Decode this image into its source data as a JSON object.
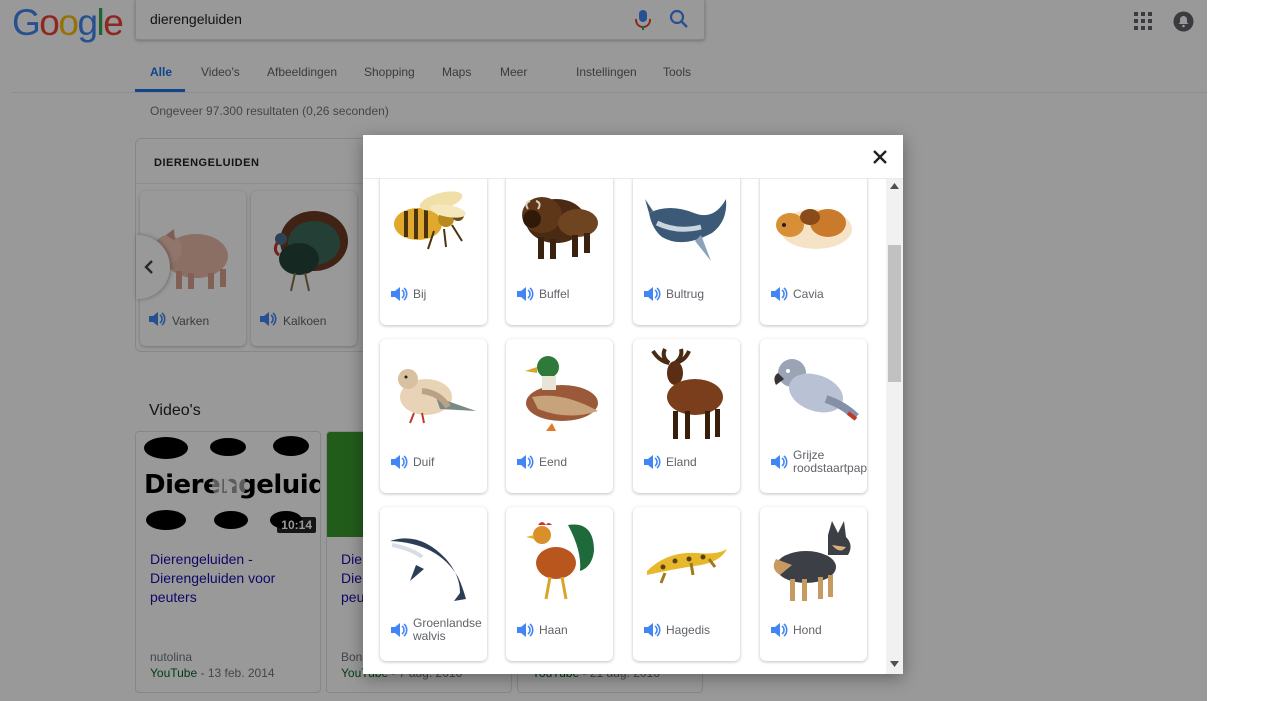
{
  "logo": {
    "letters": [
      "G",
      "o",
      "o",
      "g",
      "l",
      "e"
    ],
    "colors": [
      "#4285f4",
      "#ea4335",
      "#fbbc05",
      "#4285f4",
      "#34a853",
      "#ea4335"
    ]
  },
  "search": {
    "query": "dierengeluiden",
    "mic_icon": "mic-icon",
    "search_icon": "search-icon"
  },
  "header_icons": {
    "apps": "apps-grid-icon",
    "notifications": "bell-icon"
  },
  "tabs": [
    {
      "label": "Alle",
      "active": true
    },
    {
      "label": "Video's"
    },
    {
      "label": "Afbeeldingen"
    },
    {
      "label": "Shopping"
    },
    {
      "label": "Maps"
    },
    {
      "label": "Meer"
    },
    {
      "label": "Instellingen"
    },
    {
      "label": "Tools"
    }
  ],
  "result_stats": "Ongeveer 97.300 resultaten (0,26 seconden)",
  "knowledge_panel": {
    "title": "DIERENGELUIDEN",
    "cards": [
      {
        "label": "Varken"
      },
      {
        "label": "Kalkoen"
      }
    ]
  },
  "videos": {
    "heading": "Video's",
    "items": [
      {
        "title": "Dierengeluiden - Dierengeluiden voor peuters",
        "thumb_text": "Dierengeluiden",
        "duration": "10:14",
        "channel": "nutolina",
        "source": "YouTube",
        "date": "13 feb. 2014"
      },
      {
        "title": "Die\nDie\npeu",
        "channel": "Bon",
        "source": "YouTube",
        "date": "7 aug. 2016"
      },
      {
        "source": "YouTube",
        "date": "21 aug. 2016"
      }
    ]
  },
  "modal": {
    "close_icon": "close-icon",
    "animals": [
      {
        "label": "Bij"
      },
      {
        "label": "Buffel"
      },
      {
        "label": "Bultrug"
      },
      {
        "label": "Cavia"
      },
      {
        "label": "Duif"
      },
      {
        "label": "Eend"
      },
      {
        "label": "Eland"
      },
      {
        "label": "Grijze roodstaartpap"
      },
      {
        "label": "Groenlandse walvis"
      },
      {
        "label": "Haan"
      },
      {
        "label": "Hagedis"
      },
      {
        "label": "Hond"
      }
    ]
  },
  "colors": {
    "accent": "#1a73e8",
    "link": "#1a0dab",
    "speaker": "#4285f4",
    "youtube_green": "#006621"
  }
}
